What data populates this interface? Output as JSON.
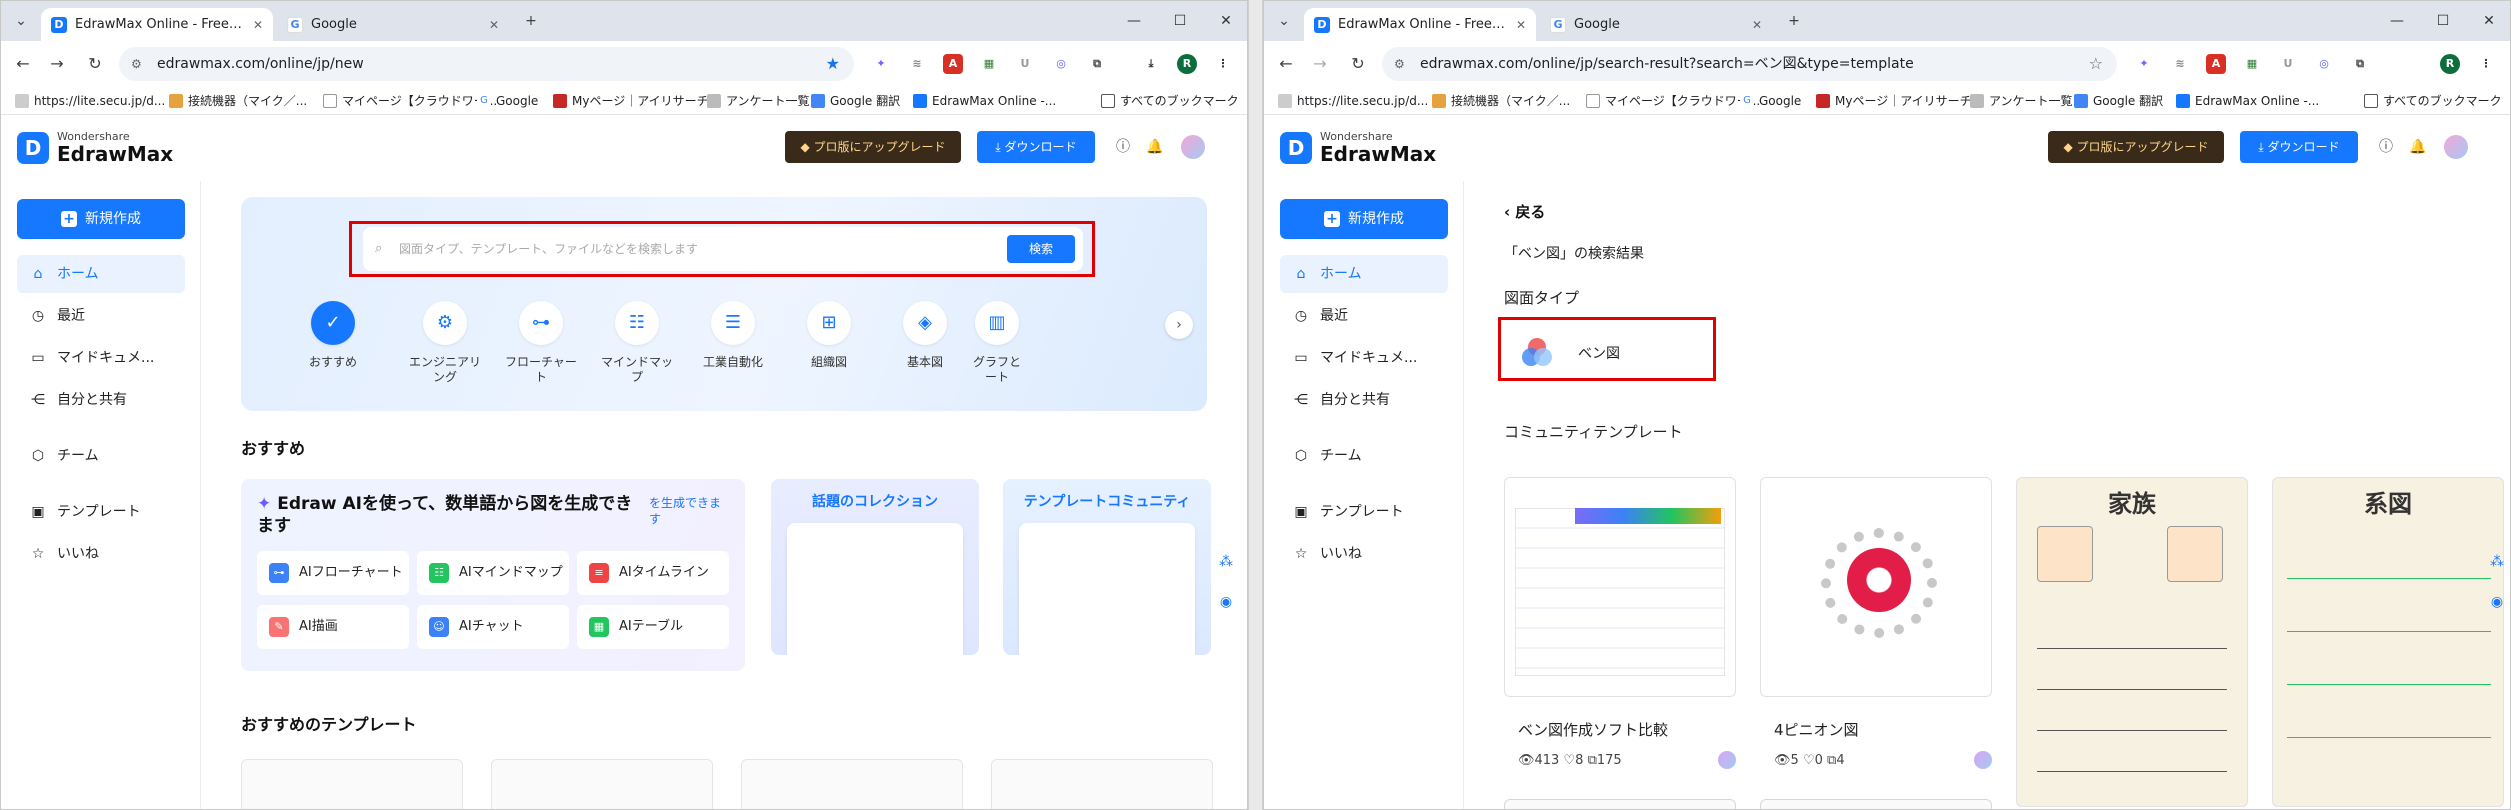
{
  "colors": {
    "accent": "#1677ff",
    "highlight_box": "#e00000",
    "upgrade_bg": "#3a2a1a",
    "upgrade_text": "#ffd58a"
  },
  "left": {
    "tabs": [
      {
        "title": "EdrawMax Online - Free Diagra",
        "favicon": "edraw-icon"
      },
      {
        "title": "Google",
        "favicon": "google-icon"
      }
    ],
    "url": "edrawmax.com/online/jp/new",
    "bookmarks": [
      "https://lite.secu.jp/d...",
      "接続機器（マイク／...",
      "マイページ【クラウドワー...",
      "Google",
      "Myページ｜アイリサーチ",
      "アンケート一覧",
      "Google 翻訳",
      "EdrawMax Online -..."
    ],
    "bookmarks_folder": "すべてのブックマーク",
    "search_placeholder": "図面タイプ、テンプレート、ファイルなどを検索します",
    "search_button": "検索",
    "categories": [
      "おすすめ",
      "エンジニアリング",
      "フローチャート",
      "マインドマップ",
      "工業自動化",
      "組織図",
      "基本図",
      "グラフとート"
    ],
    "section_recommend": "おすすめ",
    "ai_title": "Edraw AIを使って、数単語から図を生成できます",
    "ai_link": "を生成できます",
    "ai_buttons": [
      "AIフローチャート",
      "AIマインドマップ",
      "AIタイムライン",
      "AI描画",
      "AIチャット",
      "AIテーブル"
    ],
    "promo1": "話題のコレクション",
    "promo2": "テンプレートコミュニティ",
    "section_templates": "おすすめのテンプレート"
  },
  "right": {
    "tabs": [
      {
        "title": "EdrawMax Online - Free Diagra",
        "favicon": "edraw-icon"
      },
      {
        "title": "Google",
        "favicon": "google-icon"
      }
    ],
    "url": "edrawmax.com/online/jp/search-result?search=ベン図&type=template",
    "bookmarks": [
      "https://lite.secu.jp/d...",
      "接続機器（マイク／...",
      "マイページ【クラウドワー...",
      "Google",
      "Myページ｜アイリサーチ",
      "アンケート一覧",
      "Google 翻訳",
      "EdrawMax Online -..."
    ],
    "bookmarks_folder": "すべてのブックマーク",
    "back": "戻る",
    "result_text": "「ベン図」の検索結果",
    "diagram_type_heading": "図面タイプ",
    "diagram_type_item": "ベン図",
    "community_heading": "コミュニティテンプレート",
    "cards": [
      {
        "name": "ベン図作成ソフト比較",
        "views": "413",
        "likes": "8",
        "copies": "175"
      },
      {
        "name": "4ピニオン図",
        "views": "5",
        "likes": "0",
        "copies": "4"
      }
    ],
    "tall_cards": [
      "家族",
      "系図"
    ]
  },
  "app": {
    "brand_top": "Wondershare",
    "brand": "EdrawMax",
    "upgrade": "プロ版にアップグレード",
    "download": "ダウンロード",
    "new": "新規作成",
    "nav": [
      "ホーム",
      "最近",
      "マイドキュメ...",
      "自分と共有",
      "チーム",
      "テンプレート",
      "いいね"
    ]
  }
}
